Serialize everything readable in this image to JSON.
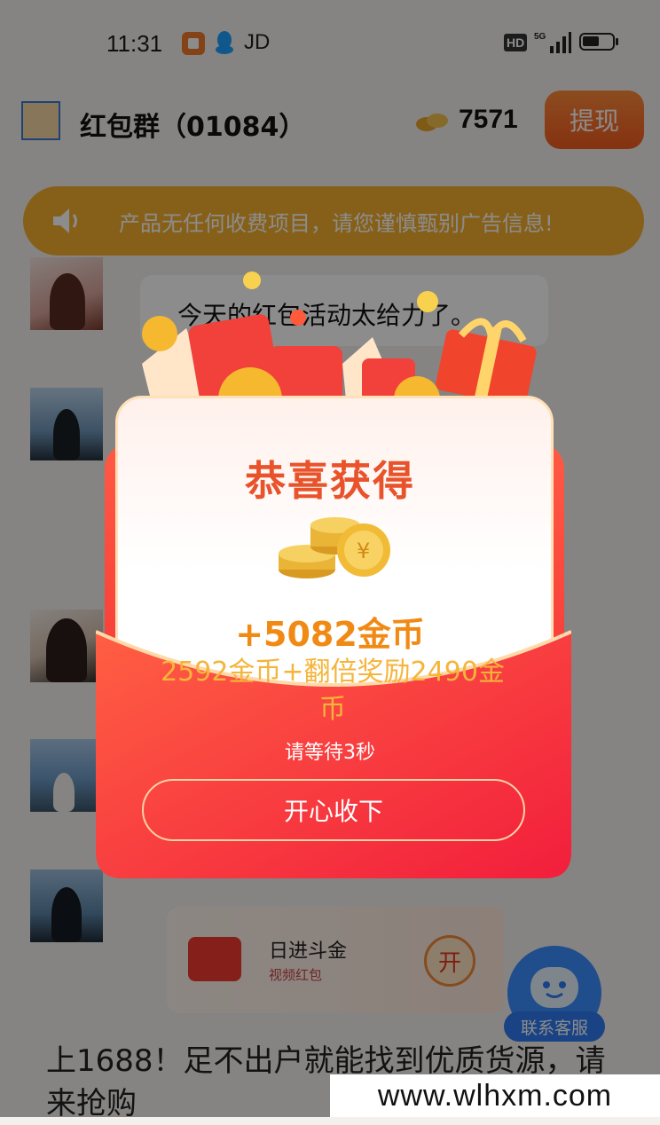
{
  "status_bar": {
    "time": "11:31",
    "carrier_text": "JD",
    "network_badge": "HD",
    "network_type": "5G"
  },
  "header": {
    "group_title": "红包群（01084）",
    "coin_count": "7571",
    "withdraw_label": "提现"
  },
  "notice": {
    "text": "产品无任何收费项目，请您谨慎甄别广告信息!"
  },
  "chat": {
    "message_1": "今天的红包活动太给力了。",
    "ad_card": {
      "title": "日进斗金",
      "subtitle": "视频红包",
      "open_label": "开"
    },
    "bottom_message": "上1688！足不出户就能找到优质货源，请来抢购"
  },
  "service": {
    "label": "联系客服"
  },
  "popup": {
    "title": "恭喜获得",
    "amount": "+5082金币",
    "detail": "2592金币+翻倍奖励2490金币",
    "wait_text": "请等待3秒",
    "accept_label": "开心收下"
  },
  "watermark": "www.wlhxm.com",
  "colors": {
    "accent_orange": "#f25c1f",
    "notice_yellow": "#f5b02d",
    "envelope_red": "#f0252f",
    "amount_orange": "#f08a15"
  }
}
